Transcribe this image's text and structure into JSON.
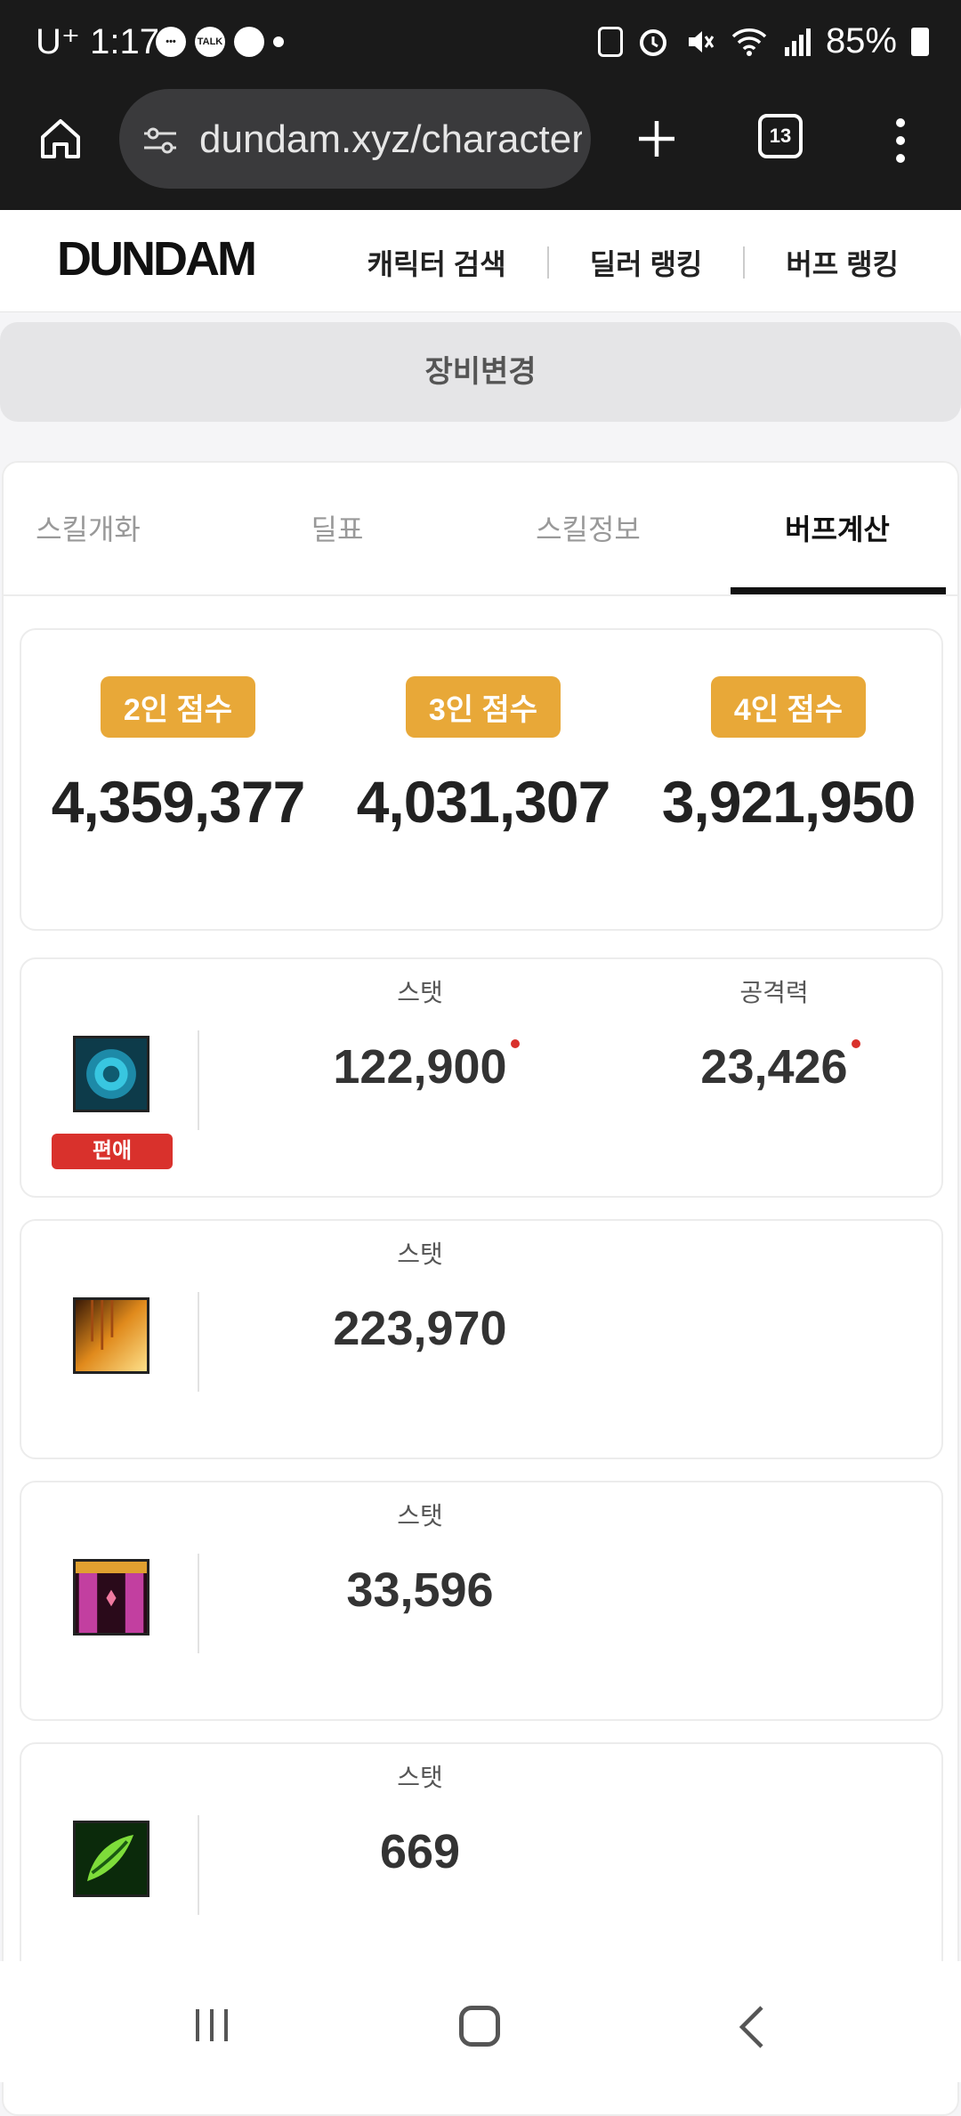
{
  "status": {
    "time": "1:17",
    "carrier": "U⁺",
    "battery": "85%",
    "notif_badge_talk": "TALK"
  },
  "browser": {
    "url": "dundam.xyz/character",
    "tab_count": "13"
  },
  "site": {
    "logo": "DUNDAM",
    "nav": [
      "캐릭터 검색",
      "딜러 랭킹",
      "버프 랭킹"
    ]
  },
  "equip_button": "장비변경",
  "tabs": [
    {
      "label": "스킬개화",
      "active": false
    },
    {
      "label": "딜표",
      "active": false
    },
    {
      "label": "스킬정보",
      "active": false
    },
    {
      "label": "버프계산",
      "active": true
    }
  ],
  "scores": [
    {
      "label": "2인 점수",
      "value": "4,359,377"
    },
    {
      "label": "3인 점수",
      "value": "4,031,307"
    },
    {
      "label": "4인 점수",
      "value": "3,921,950"
    }
  ],
  "buffs": [
    {
      "icon": "blue-rose-skill-icon",
      "tag": "편애",
      "stats": [
        {
          "label": "스탯",
          "value": "122,900",
          "marked": true
        },
        {
          "label": "공격력",
          "value": "23,426",
          "marked": true
        }
      ]
    },
    {
      "icon": "golden-flare-skill-icon",
      "stats": [
        {
          "label": "스탯",
          "value": "223,970"
        }
      ]
    },
    {
      "icon": "stage-curtain-skill-icon",
      "stats": [
        {
          "label": "스탯",
          "value": "33,596"
        }
      ]
    },
    {
      "icon": "green-leaf-skill-icon",
      "stats": [
        {
          "label": "스탯",
          "value": "669"
        }
      ]
    }
  ],
  "colors": {
    "badge": "#e8a838",
    "tag_red": "#d9312c"
  }
}
